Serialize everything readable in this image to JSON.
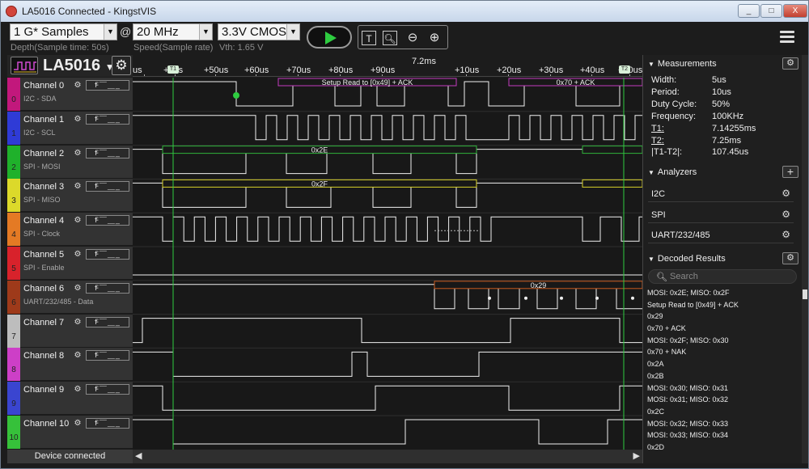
{
  "window": {
    "title": "LA5016 Connected - KingstVIS",
    "min": "_",
    "max": "□",
    "close": "X"
  },
  "toolbar": {
    "samples": "1 G* Samples",
    "samples_label": "Depth(Sample time: 50s)",
    "at": "@",
    "rate": "20 MHz",
    "rate_label": "Speed(Sample rate)",
    "voltage": "3.3V CMOS",
    "voltage_label": "Vth: 1.65 V"
  },
  "device": {
    "name": "LA5016"
  },
  "ruler": {
    "cursor_time": "7.2ms",
    "ticks": [
      "us",
      "+0us",
      "+50us",
      "+60us",
      "+70us",
      "+80us",
      "+90us",
      "+10us",
      "+20us",
      "+30us",
      "+40us",
      "+50us"
    ],
    "t1_label": "T1",
    "t2_label": "T2"
  },
  "channels": [
    {
      "name": "Channel 0",
      "sub": "I2C - SDA",
      "n": "0",
      "color": "#c2187c"
    },
    {
      "name": "Channel 1",
      "sub": "I2C - SCL",
      "n": "1",
      "color": "#2f3bd6"
    },
    {
      "name": "Channel 2",
      "sub": "SPI - MOSI",
      "n": "2",
      "color": "#1fb12b"
    },
    {
      "name": "Channel 3",
      "sub": "SPI - MISO",
      "n": "3",
      "color": "#dcd92a"
    },
    {
      "name": "Channel 4",
      "sub": "SPI - Clock",
      "n": "4",
      "color": "#e47a24"
    },
    {
      "name": "Channel 5",
      "sub": "SPI - Enable",
      "n": "5",
      "color": "#d8222b"
    },
    {
      "name": "Channel 6",
      "sub": "UART/232/485 - Data",
      "n": "6",
      "color": "#9e3a1a"
    },
    {
      "name": "Channel 7",
      "sub": "",
      "n": "7",
      "color": "#bdbdbd"
    },
    {
      "name": "Channel 8",
      "sub": "",
      "n": "8",
      "color": "#cd3fc7"
    },
    {
      "name": "Channel 9",
      "sub": "",
      "n": "9",
      "color": "#3a45d0"
    },
    {
      "name": "Channel 10",
      "sub": "",
      "n": "10",
      "color": "#36c13a"
    }
  ],
  "decode": {
    "i2c_a": "Setup Read to [0x49] + ACK",
    "i2c_b": "0x70 + ACK",
    "spi_mosi": "0x2E",
    "spi_miso": "0x2F",
    "uart": "0x29"
  },
  "status": "Device connected",
  "measurements": {
    "title": "Measurements",
    "rows": [
      {
        "k": "Width:",
        "v": "5us"
      },
      {
        "k": "Period:",
        "v": "10us"
      },
      {
        "k": "Duty Cycle:",
        "v": "50%"
      },
      {
        "k": "Frequency:",
        "v": "100KHz"
      },
      {
        "k": "T1:",
        "v": "7.14255ms"
      },
      {
        "k": "T2:",
        "v": "7.25ms"
      },
      {
        "k": "|T1-T2|:",
        "v": "107.45us"
      }
    ]
  },
  "analyzers": {
    "title": "Analyzers",
    "items": [
      "I2C",
      "SPI",
      "UART/232/485"
    ]
  },
  "decoded": {
    "title": "Decoded Results",
    "search_placeholder": "Search",
    "items": [
      "MOSI: 0x2E;  MISO: 0x2F",
      "Setup Read to [0x49] + ACK",
      "0x29",
      "0x70 + ACK",
      "MOSI: 0x2F;  MISO: 0x30",
      "0x70 + NAK",
      "0x2A",
      "0x2B",
      "MOSI: 0x30;  MISO: 0x31",
      "MOSI: 0x31;  MISO: 0x32",
      "0x2C",
      "MOSI: 0x32;  MISO: 0x33",
      "MOSI: 0x33;  MISO: 0x34",
      "0x2D"
    ]
  }
}
